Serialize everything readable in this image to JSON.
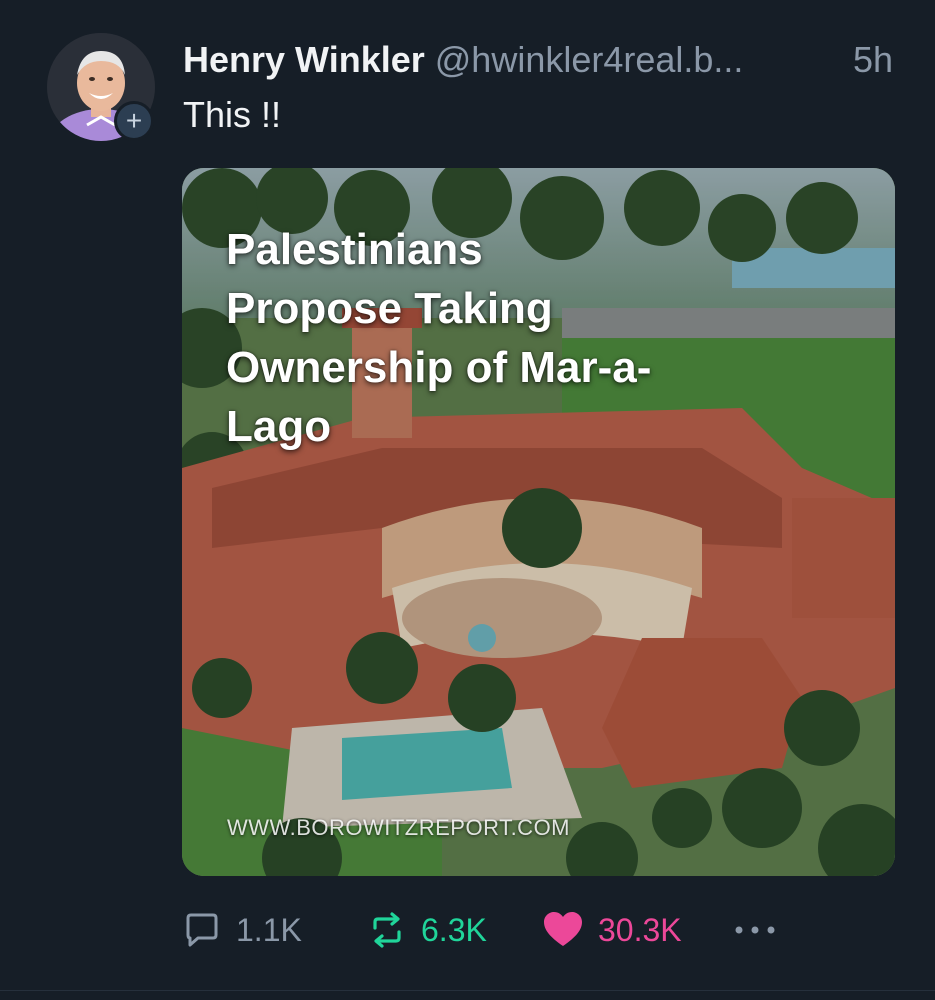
{
  "post": {
    "author": {
      "display_name": "Henry Winkler",
      "handle": "@hwinkler4real.b...",
      "avatar_icon": "avatar-photo",
      "follow_icon": "plus-icon"
    },
    "time": "5h",
    "text": "This !!",
    "embed": {
      "headline": "Palestinians\nPropose Taking\nOwnership of Mar-a-\nLago",
      "watermark": "WWW.BOROWITZREPORT.COM"
    },
    "actions": {
      "reply": {
        "icon": "reply-icon",
        "count": "1.1K"
      },
      "repost": {
        "icon": "repost-icon",
        "count": "6.3K",
        "color": "#20d59a"
      },
      "like": {
        "icon": "heart-icon",
        "count": "30.3K",
        "color": "#ec4899"
      },
      "more": {
        "icon": "more-icon"
      }
    }
  }
}
